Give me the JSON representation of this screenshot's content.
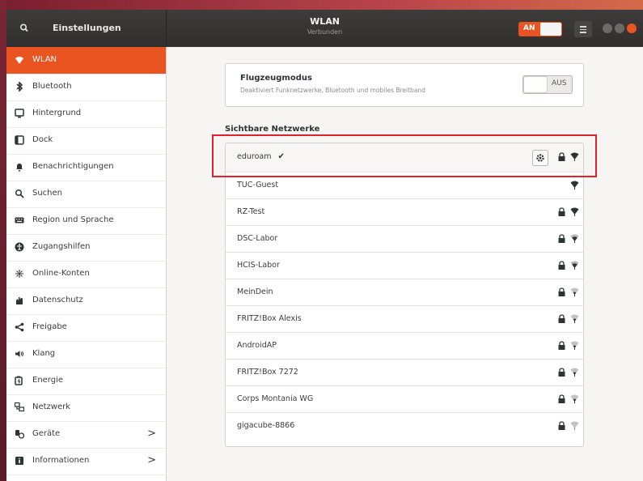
{
  "header": {
    "left_title": "Einstellungen",
    "title": "WLAN",
    "subtitle": "Verbunden",
    "wifi_toggle_label": "AN",
    "accent_color": "#e95420"
  },
  "sidebar": {
    "items": [
      {
        "label": "WLAN",
        "icon": "wifi-icon",
        "active": true
      },
      {
        "label": "Bluetooth",
        "icon": "bluetooth-icon"
      },
      {
        "label": "Hintergrund",
        "icon": "background-icon"
      },
      {
        "label": "Dock",
        "icon": "dock-icon"
      },
      {
        "label": "Benachrichtigungen",
        "icon": "bell-icon"
      },
      {
        "label": "Suchen",
        "icon": "search-icon"
      },
      {
        "label": "Region und Sprache",
        "icon": "keyboard-icon"
      },
      {
        "label": "Zugangshilfen",
        "icon": "accessibility-icon"
      },
      {
        "label": "Online-Konten",
        "icon": "online-accounts-icon"
      },
      {
        "label": "Datenschutz",
        "icon": "hand-icon"
      },
      {
        "label": "Freigabe",
        "icon": "share-icon"
      },
      {
        "label": "Klang",
        "icon": "speaker-icon"
      },
      {
        "label": "Energie",
        "icon": "battery-icon"
      },
      {
        "label": "Netzwerk",
        "icon": "network-icon"
      },
      {
        "label": "Geräte",
        "icon": "devices-icon",
        "chevron": ">"
      },
      {
        "label": "Informationen",
        "icon": "info-icon",
        "chevron": ">"
      }
    ]
  },
  "airplane": {
    "title": "Flugzeugmodus",
    "description": "Deaktiviert Funknetzwerke, Bluetooth und mobiles Breitband",
    "switch_label": "AUS"
  },
  "networks": {
    "heading": "Sichtbare Netzwerke",
    "items": [
      {
        "name": "eduroam",
        "connected_mark": "✔",
        "secured": true,
        "signal": "strong",
        "has_settings": true
      },
      {
        "name": "TUC-Guest",
        "secured": false,
        "signal": "strong"
      },
      {
        "name": "RZ-Test",
        "secured": true,
        "signal": "strong"
      },
      {
        "name": "DSC-Labor",
        "secured": true,
        "signal": "medium"
      },
      {
        "name": "HCIS-Labor",
        "secured": true,
        "signal": "medium"
      },
      {
        "name": "MeinDein",
        "secured": true,
        "signal": "weak"
      },
      {
        "name": "FRITZ!Box Alexis",
        "secured": true,
        "signal": "weak"
      },
      {
        "name": "AndroidAP",
        "secured": true,
        "signal": "weak"
      },
      {
        "name": "FRITZ!Box 7272",
        "secured": true,
        "signal": "weak"
      },
      {
        "name": "Corps Montania WG",
        "secured": true,
        "signal": "weak"
      },
      {
        "name": "gigacube-8866",
        "secured": true,
        "signal": "very-weak"
      }
    ]
  }
}
